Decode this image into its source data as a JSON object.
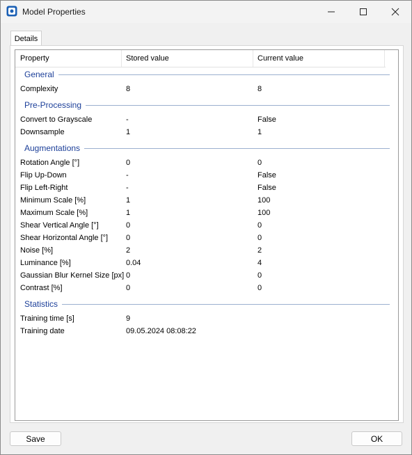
{
  "window": {
    "title": "Model Properties",
    "minimize_icon": "minimize-icon",
    "maximize_icon": "maximize-icon",
    "close_icon": "close-icon"
  },
  "tabs": [
    {
      "label": "Details"
    }
  ],
  "grid": {
    "columns": [
      "Property",
      "Stored value",
      "Current value"
    ],
    "groups": [
      {
        "name": "General",
        "rows": [
          {
            "property": "Complexity",
            "stored": "8",
            "current": "8"
          }
        ]
      },
      {
        "name": "Pre-Processing",
        "rows": [
          {
            "property": "Convert to Grayscale",
            "stored": "-",
            "current": "False"
          },
          {
            "property": "Downsample",
            "stored": "1",
            "current": "1"
          }
        ]
      },
      {
        "name": "Augmentations",
        "rows": [
          {
            "property": "Rotation Angle [°]",
            "stored": "0",
            "current": "0"
          },
          {
            "property": "Flip Up-Down",
            "stored": "-",
            "current": "False"
          },
          {
            "property": "Flip Left-Right",
            "stored": "-",
            "current": "False"
          },
          {
            "property": "Minimum Scale [%]",
            "stored": "1",
            "current": "100"
          },
          {
            "property": "Maximum Scale [%]",
            "stored": "1",
            "current": "100"
          },
          {
            "property": "Shear Vertical Angle [°]",
            "stored": "0",
            "current": "0"
          },
          {
            "property": "Shear Horizontal Angle [°]",
            "stored": "0",
            "current": "0"
          },
          {
            "property": "Noise [%]",
            "stored": "2",
            "current": "2"
          },
          {
            "property": "Luminance [%]",
            "stored": "0.04",
            "current": "4"
          },
          {
            "property": "Gaussian Blur Kernel Size [px]",
            "stored": "0",
            "current": "0"
          },
          {
            "property": "Contrast [%]",
            "stored": "0",
            "current": "0"
          }
        ]
      },
      {
        "name": "Statistics",
        "rows": [
          {
            "property": "Training time [s]",
            "stored": "9",
            "current": ""
          },
          {
            "property": "Training date",
            "stored": "09.05.2024 08:08:22",
            "current": ""
          }
        ]
      }
    ]
  },
  "buttons": {
    "save": "Save",
    "ok": "OK"
  },
  "colors": {
    "group_header": "#1c3f99",
    "app_icon": "#1a5fb4"
  }
}
